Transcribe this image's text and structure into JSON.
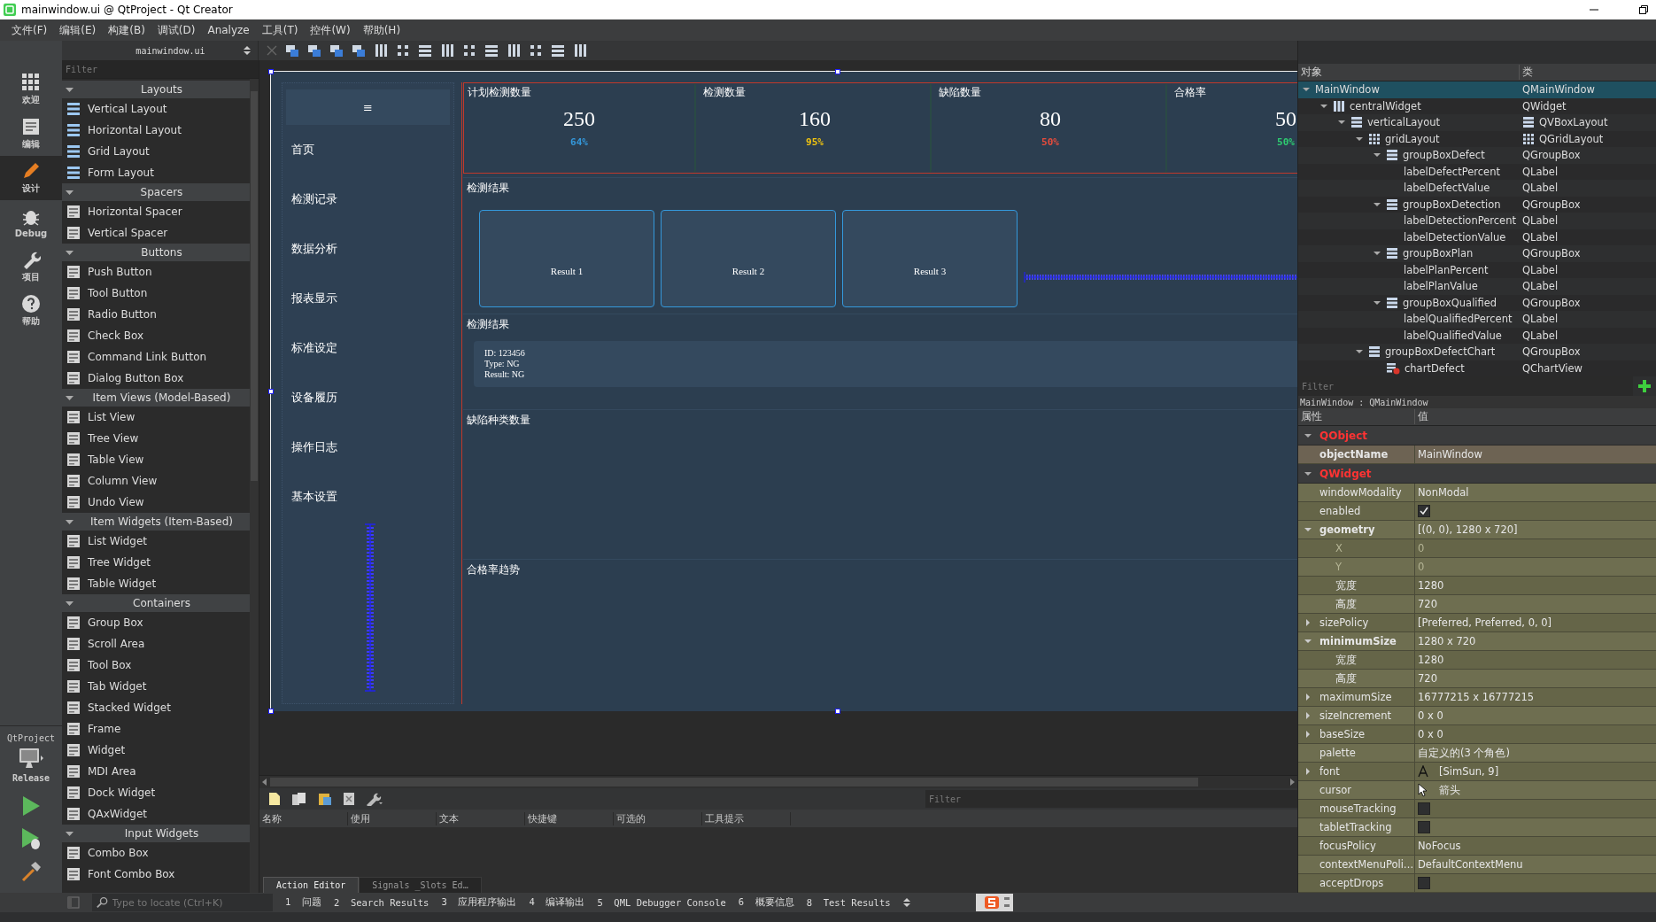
{
  "window": {
    "title": "mainwindow.ui @ QtProject - Qt Creator"
  },
  "menu": [
    "文件(F)",
    "编辑(E)",
    "构建(B)",
    "调试(D)",
    "Analyze",
    "工具(T)",
    "控件(W)",
    "帮助(H)"
  ],
  "mode_bar": {
    "items": [
      {
        "label": "欢迎",
        "selected": false
      },
      {
        "label": "编辑",
        "selected": false
      },
      {
        "label": "设计",
        "selected": true
      },
      {
        "label": "Debug",
        "selected": false
      },
      {
        "label": "项目",
        "selected": false
      },
      {
        "label": "帮助",
        "selected": false
      }
    ],
    "project": {
      "name": "QtProject",
      "config": "Release"
    }
  },
  "editor_toolbar": {
    "document": "mainwindow.ui"
  },
  "widget_box": {
    "filter": {
      "placeholder": "Filter"
    },
    "groups": [
      {
        "title": "Layouts",
        "expanded": true,
        "items": [
          "Vertical Layout",
          "Horizontal Layout",
          "Grid Layout",
          "Form Layout"
        ]
      },
      {
        "title": "Spacers",
        "expanded": true,
        "items": [
          "Horizontal Spacer",
          "Vertical Spacer"
        ]
      },
      {
        "title": "Buttons",
        "expanded": true,
        "items": [
          "Push Button",
          "Tool Button",
          "Radio Button",
          "Check Box",
          "Command Link Button",
          "Dialog Button Box"
        ]
      },
      {
        "title": "Item Views (Model-Based)",
        "expanded": true,
        "items": [
          "List View",
          "Tree View",
          "Table View",
          "Column View",
          "Undo View"
        ]
      },
      {
        "title": "Item Widgets (Item-Based)",
        "expanded": true,
        "items": [
          "List Widget",
          "Tree Widget",
          "Table Widget"
        ]
      },
      {
        "title": "Containers",
        "expanded": true,
        "items": [
          "Group Box",
          "Scroll Area",
          "Tool Box",
          "Tab Widget",
          "Stacked Widget",
          "Frame",
          "Widget",
          "MDI Area",
          "Dock Widget",
          "QAxWidget"
        ]
      },
      {
        "title": "Input Widgets",
        "expanded": true,
        "items": [
          "Combo Box",
          "Font Combo Box"
        ]
      }
    ]
  },
  "form": {
    "nav": {
      "menu_glyph": "≡",
      "items": [
        "首页",
        "检测记录",
        "数据分析",
        "报表显示",
        "标准设定",
        "设备履历",
        "操作日志",
        "基本设置"
      ]
    },
    "kpis": [
      {
        "title": "计划检测数量",
        "value": "250",
        "percent": "64%",
        "color": "#3498db"
      },
      {
        "title": "检测数量",
        "value": "160",
        "percent": "95%",
        "color": "#f1c40f"
      },
      {
        "title": "缺陷数量",
        "value": "80",
        "percent": "50%",
        "color": "#e74c3c"
      },
      {
        "title": "合格率",
        "value": "50",
        "percent": "50%",
        "color": "#2ecc71"
      }
    ],
    "results": {
      "title": "检测结果",
      "cards": [
        "Result 1",
        "Result 2",
        "Result 3"
      ]
    },
    "detail": {
      "title": "检测结果",
      "lines": [
        "ID: 123456",
        "Type: NG",
        "Result: NG"
      ]
    },
    "defect_chart": {
      "title": "缺陷种类数量"
    },
    "trend_chart": {
      "title": "合格率趋势"
    }
  },
  "action_editor": {
    "filter": {
      "placeholder": "Filter"
    },
    "columns": [
      "名称",
      "使用",
      "文本",
      "快捷键",
      "可选的",
      "工具提示"
    ],
    "tabs": [
      {
        "label": "Action Editor",
        "selected": true
      },
      {
        "label": "Signals _Slots Ed…",
        "selected": false
      }
    ]
  },
  "object_inspector": {
    "columns": [
      "对象",
      "类"
    ],
    "tree": [
      {
        "name": "MainWindow",
        "class": "QMainWindow",
        "selected": true,
        "expanded": true,
        "children": [
          {
            "name": "centralWidget",
            "class": "QWidget",
            "kind": "hbox",
            "selected": false,
            "expanded": true,
            "children": [
              {
                "name": "verticalLayout",
                "class": "QVBoxLayout",
                "kind": "vbox",
                "layout": true,
                "selected": false,
                "expanded": true,
                "children": [
                  {
                    "name": "gridLayout",
                    "class": "QGridLayout",
                    "kind": "grid",
                    "layout": true,
                    "selected": false,
                    "expanded": true,
                    "children": [
                      {
                        "name": "groupBoxDefect",
                        "class": "QGroupBox",
                        "kind": "vbox",
                        "selected": false,
                        "expanded": true,
                        "children": [
                          {
                            "name": "labelDefectPercent",
                            "class": "QLabel",
                            "selected": false
                          },
                          {
                            "name": "labelDefectValue",
                            "class": "QLabel",
                            "selected": false
                          }
                        ]
                      },
                      {
                        "name": "groupBoxDetection",
                        "class": "QGroupBox",
                        "kind": "vbox",
                        "selected": false,
                        "expanded": true,
                        "children": [
                          {
                            "name": "labelDetectionPercent",
                            "class": "QLabel",
                            "selected": false
                          },
                          {
                            "name": "labelDetectionValue",
                            "class": "QLabel",
                            "selected": false
                          }
                        ]
                      },
                      {
                        "name": "groupBoxPlan",
                        "class": "QGroupBox",
                        "kind": "vbox",
                        "selected": false,
                        "expanded": true,
                        "children": [
                          {
                            "name": "labelPlanPercent",
                            "class": "QLabel",
                            "selected": false
                          },
                          {
                            "name": "labelPlanValue",
                            "class": "QLabel",
                            "selected": false
                          }
                        ]
                      },
                      {
                        "name": "groupBoxQualified",
                        "class": "QGroupBox",
                        "kind": "vbox",
                        "selected": false,
                        "expanded": true,
                        "children": [
                          {
                            "name": "labelQualifiedPercent",
                            "class": "QLabel",
                            "selected": false
                          },
                          {
                            "name": "labelQualifiedValue",
                            "class": "QLabel",
                            "selected": false
                          }
                        ]
                      }
                    ]
                  },
                  {
                    "name": "groupBoxDefectChart",
                    "class": "QGroupBox",
                    "kind": "vbox",
                    "selected": false,
                    "expanded": true,
                    "children": [
                      {
                        "name": "chartDefect",
                        "class": "QChartView",
                        "kind": "chart",
                        "selected": false
                      }
                    ]
                  }
                ]
              }
            ]
          }
        ]
      }
    ]
  },
  "property_editor": {
    "filter": {
      "placeholder": "Filter"
    },
    "object_label": "MainWindow : QMainWindow",
    "columns": [
      "属性",
      "值"
    ],
    "groups": [
      {
        "name": "QObject",
        "expanded": true,
        "properties": [
          {
            "name": "objectName",
            "kind": "text",
            "value": "MainWindow",
            "modified": true
          }
        ]
      },
      {
        "name": "QWidget",
        "expanded": true,
        "properties": [
          {
            "name": "windowModality",
            "kind": "text",
            "value": "NonModal",
            "modified": false
          },
          {
            "name": "enabled",
            "kind": "check",
            "checked": true,
            "modified": false
          },
          {
            "name": "geometry",
            "kind": "text",
            "value": "[(0, 0), 1280 x 720]",
            "modified": true,
            "expanded": true,
            "children": [
              {
                "name": "X",
                "value": "0",
                "disabled": true
              },
              {
                "name": "Y",
                "value": "0",
                "disabled": true
              },
              {
                "name": "宽度",
                "value": "1280",
                "disabled": false
              },
              {
                "name": "高度",
                "value": "720",
                "disabled": false
              }
            ]
          },
          {
            "name": "sizePolicy",
            "kind": "text",
            "value": "[Preferred, Preferred, 0, 0]",
            "modified": false,
            "expanded": false
          },
          {
            "name": "minimumSize",
            "kind": "text",
            "value": "1280 x 720",
            "modified": true,
            "expanded": true,
            "children": [
              {
                "name": "宽度",
                "value": "1280",
                "disabled": false
              },
              {
                "name": "高度",
                "value": "720",
                "disabled": false
              }
            ]
          },
          {
            "name": "maximumSize",
            "kind": "text",
            "value": "16777215 x 16777215",
            "modified": false,
            "expanded": false
          },
          {
            "name": "sizeIncrement",
            "kind": "text",
            "value": "0 x 0",
            "modified": false,
            "expanded": false
          },
          {
            "name": "baseSize",
            "kind": "text",
            "value": "0 x 0",
            "modified": false,
            "expanded": false
          },
          {
            "name": "palette",
            "kind": "text",
            "value": "自定义的(3 个角色)",
            "modified": false
          },
          {
            "name": "font",
            "kind": "font",
            "value": "[SimSun, 9]",
            "modified": false,
            "expanded": false
          },
          {
            "name": "cursor",
            "kind": "cursor",
            "value": "箭头",
            "modified": false
          },
          {
            "name": "mouseTracking",
            "kind": "check",
            "checked": false,
            "modified": false
          },
          {
            "name": "tabletTracking",
            "kind": "check",
            "checked": false,
            "modified": false
          },
          {
            "name": "focusPolicy",
            "kind": "text",
            "value": "NoFocus",
            "modified": false
          },
          {
            "name": "contextMenuPoli…",
            "kind": "text",
            "value": "DefaultContextMenu",
            "modified": false
          },
          {
            "name": "acceptDrops",
            "kind": "check",
            "checked": false,
            "modified": false
          }
        ]
      }
    ]
  },
  "status_bar": {
    "locate": {
      "placeholder": "Type to locate (Ctrl+K)"
    },
    "panes": [
      "1  问题",
      "2  Search Results",
      "3  应用程序输出",
      "4  编译输出",
      "5  QML Debugger Console",
      "6  概要信息",
      "8  Test Results"
    ]
  }
}
